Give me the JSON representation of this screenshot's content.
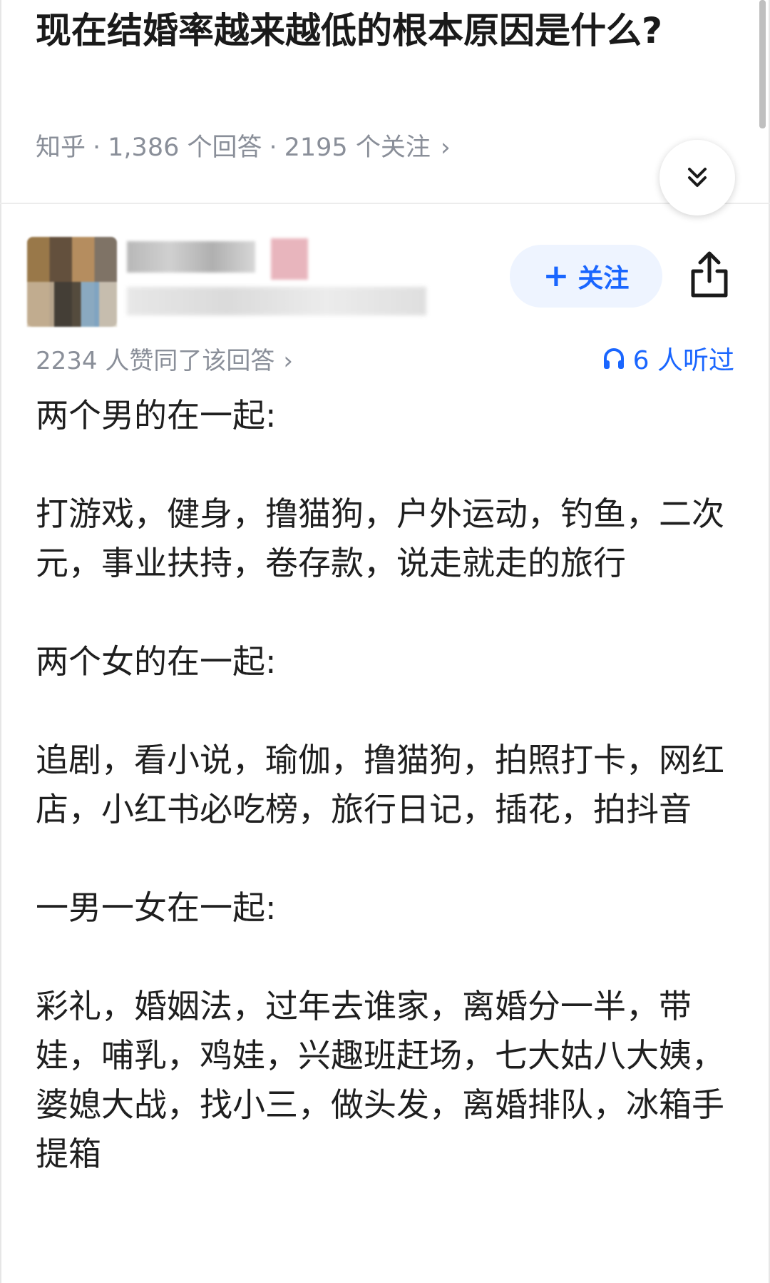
{
  "question": {
    "title": "现在结婚率越来越低的根本原因是什么?",
    "source": "知乎",
    "answers_count": "1,386 个回答",
    "follow_count": "2195 个关注",
    "meta_chevron": "›"
  },
  "author_card": {
    "follow_plus": "+",
    "follow_label": "关注"
  },
  "stats": {
    "upvotes": "2234 人赞同了该回答",
    "upvotes_chevron": "›",
    "listeners": "6 人听过"
  },
  "answer": {
    "paragraphs": [
      "两个男的在一起:",
      "打游戏，健身，撸猫狗，户外运动，钓鱼，二次元，事业扶持，卷存款，说走就走的旅行",
      "两个女的在一起:",
      "追剧，看小说，瑜伽，撸猫狗，拍照打卡，网红店，小红书必吃榜，旅行日记，插花，拍抖音",
      "一男一女在一起:",
      "彩礼，婚姻法，过年去谁家，离婚分一半，带娃，哺乳，鸡娃，兴趣班赶场，七大姑八大姨，婆媳大战，找小三，做头发，离婚排队，冰箱手提箱"
    ]
  },
  "colors": {
    "accent": "#1a66ff",
    "follow_bg": "#eef4ff",
    "meta_gray": "#8a8f99",
    "text": "#1f1f1f"
  },
  "icons": {
    "collapse": "double-chevron-down-icon",
    "share": "share-icon",
    "listen": "headphones-icon"
  }
}
